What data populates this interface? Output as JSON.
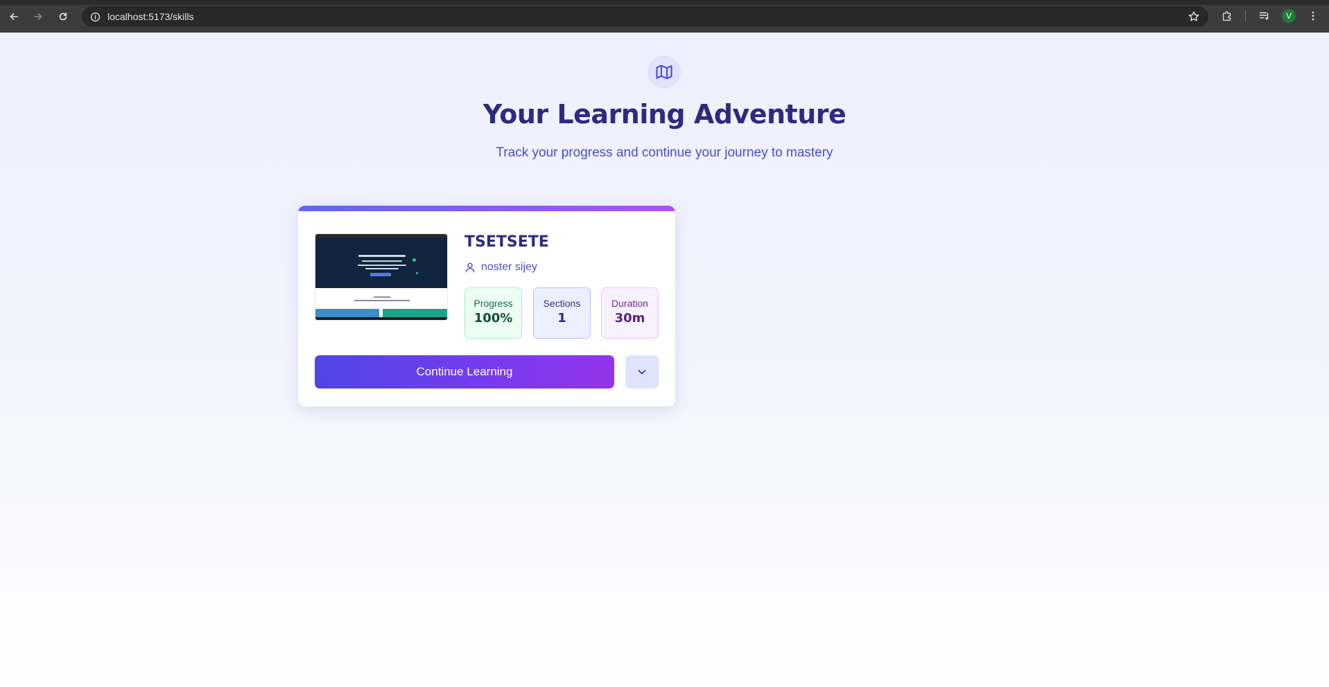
{
  "browser": {
    "url": "localhost:5173/skills",
    "profile_initial": "V",
    "icons": [
      "back-arrow-icon",
      "forward-arrow-icon",
      "reload-icon",
      "site-info-icon",
      "bookmark-star-icon",
      "extensions-icon",
      "media-controls-icon"
    ]
  },
  "hero": {
    "icon": "map-icon",
    "title": "Your Learning Adventure",
    "subtitle": "Track your progress and continue your journey to mastery"
  },
  "course": {
    "title": "TSETSETE",
    "instructor": "noster sijey",
    "stats": {
      "progress_label": "Progress",
      "progress_value": "100%",
      "sections_label": "Sections",
      "sections_value": "1",
      "duration_label": "Duration",
      "duration_value": "30m"
    },
    "continue_label": "Continue Learning",
    "expand_icon": "chevron-down-icon"
  },
  "colors": {
    "title": "#2e2a80",
    "accent_start": "#4f46e5",
    "accent_end": "#9333ea",
    "subtitle": "#4b4bc8"
  }
}
